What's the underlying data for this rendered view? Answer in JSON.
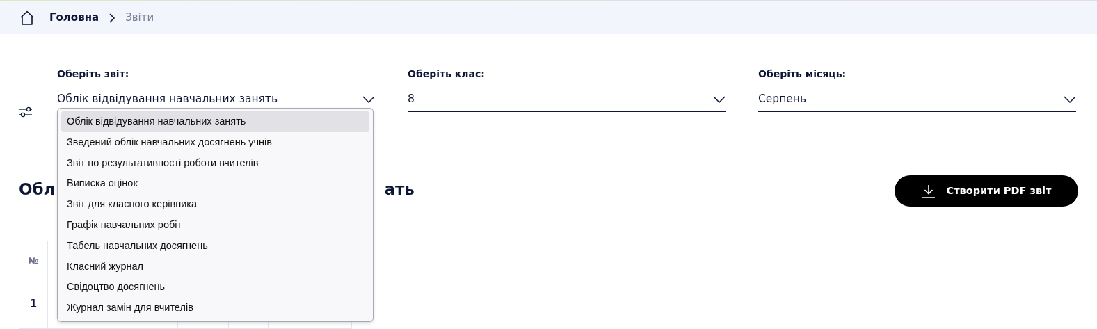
{
  "breadcrumb": [
    {
      "label": "Головна",
      "current": false
    },
    {
      "label": "Звіти",
      "current": true
    }
  ],
  "filters": [
    {
      "label": "Оберіть звіт:",
      "value": "Облік відвідування навчальних занять",
      "open": true
    },
    {
      "label": "Оберіть клас:",
      "value": "8",
      "open": false
    },
    {
      "label": "Оберіть місяць:",
      "value": "Серпень",
      "open": false
    }
  ],
  "report_options": [
    {
      "label": "Облік відвідування навчальних занять",
      "selected": true
    },
    {
      "label": "Зведений облік навчальних досягнень учнів",
      "selected": false
    },
    {
      "label": "Звіт по результативності роботи вчителів",
      "selected": false
    },
    {
      "label": "Виписка оцінок",
      "selected": false
    },
    {
      "label": "Звіт для класного керівника",
      "selected": false
    },
    {
      "label": "Графік навчальних робіт",
      "selected": false
    },
    {
      "label": "Табель навчальних досягнень",
      "selected": false
    },
    {
      "label": "Класний журнал",
      "selected": false
    },
    {
      "label": "Свідоцтво досягнень",
      "selected": false
    },
    {
      "label": "Журнал замін для вчителів",
      "selected": false
    }
  ],
  "heading": {
    "visible_start": "Обл",
    "visible_end": "ать"
  },
  "pdf_button": {
    "label": "Створити PDF звіт"
  },
  "table": {
    "columns": [
      "№"
    ],
    "rows": [
      [
        "1"
      ]
    ]
  }
}
